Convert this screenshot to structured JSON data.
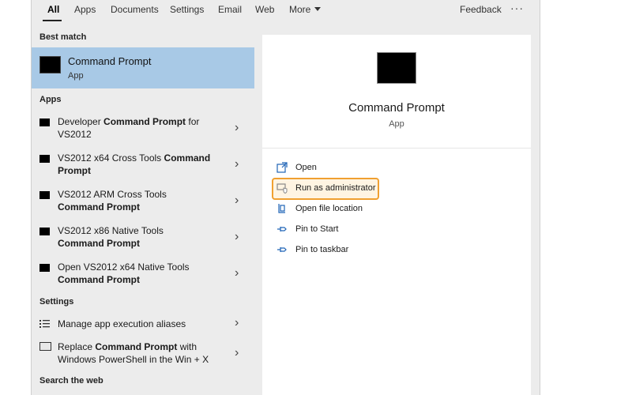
{
  "tabs": [
    "All",
    "Apps",
    "Documents",
    "Settings",
    "Email",
    "Web",
    "More"
  ],
  "feedback": "Feedback",
  "more_menu": "···",
  "left": {
    "best_match_title": "Best match",
    "best_match": {
      "name": "Command Prompt",
      "type": "App"
    },
    "apps_title": "Apps",
    "apps": [
      {
        "pre": "Developer ",
        "bold": "Command Prompt",
        "post": " for VS2012"
      },
      {
        "pre": "VS2012 x64 Cross Tools ",
        "bold": "Command Prompt",
        "post": ""
      },
      {
        "pre": "VS2012 ARM Cross Tools ",
        "bold": "Command Prompt",
        "post": ""
      },
      {
        "pre": "VS2012 x86 Native Tools ",
        "bold": "Command Prompt",
        "post": ""
      },
      {
        "pre": "Open VS2012 x64 Native Tools ",
        "bold": "Command Prompt",
        "post": ""
      }
    ],
    "settings_title": "Settings",
    "settings": [
      {
        "pre": "Manage app execution aliases",
        "bold": "",
        "post": ""
      },
      {
        "pre": "Replace ",
        "bold": "Command Prompt",
        "post": " with Windows PowerShell in the Win + X"
      }
    ],
    "web_title": "Search the web"
  },
  "right": {
    "title": "Command Prompt",
    "subtitle": "App",
    "actions": [
      "Open",
      "Run as administrator",
      "Open file location",
      "Pin to Start",
      "Pin to taskbar"
    ]
  },
  "colors": {
    "selection": "#a8c9e6",
    "highlight": "#f0a030",
    "accent": "#1e63b6"
  }
}
